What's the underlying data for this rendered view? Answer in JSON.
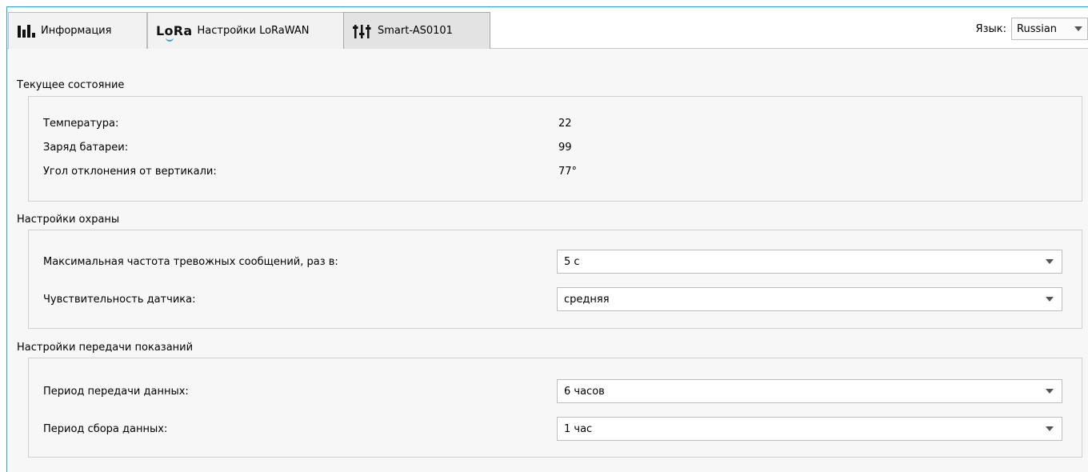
{
  "tabs": [
    {
      "label": "Информация",
      "icon": "bar-chart-icon"
    },
    {
      "label": "Настройки LoRaWAN",
      "icon": "lora-icon",
      "icon_text": "LoRa"
    },
    {
      "label": "Smart-AS0101",
      "icon": "sliders-icon"
    }
  ],
  "language": {
    "label": "Язык:",
    "value": "Russian"
  },
  "status": {
    "title": "Текущее состояние",
    "rows": [
      {
        "label": "Температура:",
        "value": "22"
      },
      {
        "label": "Заряд батареи:",
        "value": "99"
      },
      {
        "label": "Угол отклонения от вертикали:",
        "value": "77°"
      }
    ]
  },
  "security": {
    "title": "Настройки охраны",
    "rows": [
      {
        "label": "Максимальная частота тревожных сообщений, раз в:",
        "value": "5 с"
      },
      {
        "label": "Чувствительность датчика:",
        "value": "средняя"
      }
    ]
  },
  "transmission": {
    "title": "Настройки передачи показаний",
    "rows": [
      {
        "label": "Период передачи данных:",
        "value": "6 часов"
      },
      {
        "label": "Период сбора данных:",
        "value": "1 час"
      }
    ]
  },
  "colors": {
    "accent": "#2aa0d8",
    "background": "#f7f7f7",
    "border": "#d0d0d0"
  }
}
